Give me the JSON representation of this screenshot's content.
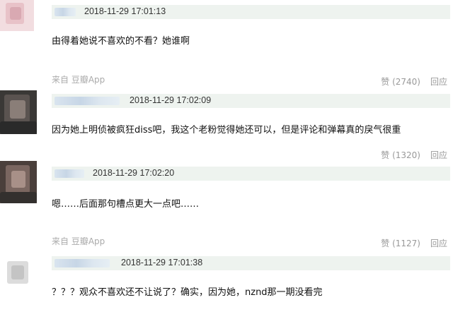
{
  "comments": [
    {
      "timestamp": "2018-11-29 17:01:13",
      "text": "由得着她说不喜欢的不看？她谁啊",
      "source": "来自 豆瓣App",
      "vote_label": "赞 (2740)",
      "reply_label": "回应"
    },
    {
      "timestamp": "2018-11-29 17:02:09",
      "text": "因为她上明侦被疯狂diss吧，我这个老粉觉得她还可以，但是评论和弹幕真的戾气很重",
      "source": "",
      "vote_label": "赞 (1320)",
      "reply_label": "回应"
    },
    {
      "timestamp": "2018-11-29 17:02:20",
      "text": "嗯……后面那句槽点更大一点吧……",
      "source": "来自 豆瓣App",
      "vote_label": "赞 (1127)",
      "reply_label": "回应"
    },
    {
      "timestamp": "2018-11-29 17:01:38",
      "text": "？？？观众不喜欢还不让说了？确实，因为她，nznd那一期没看完",
      "source": "",
      "vote_label": "",
      "reply_label": ""
    }
  ],
  "colors": {
    "header_bg": "#eef3ef",
    "source_text": "#aaaaaa",
    "vote_text": "#999999"
  }
}
